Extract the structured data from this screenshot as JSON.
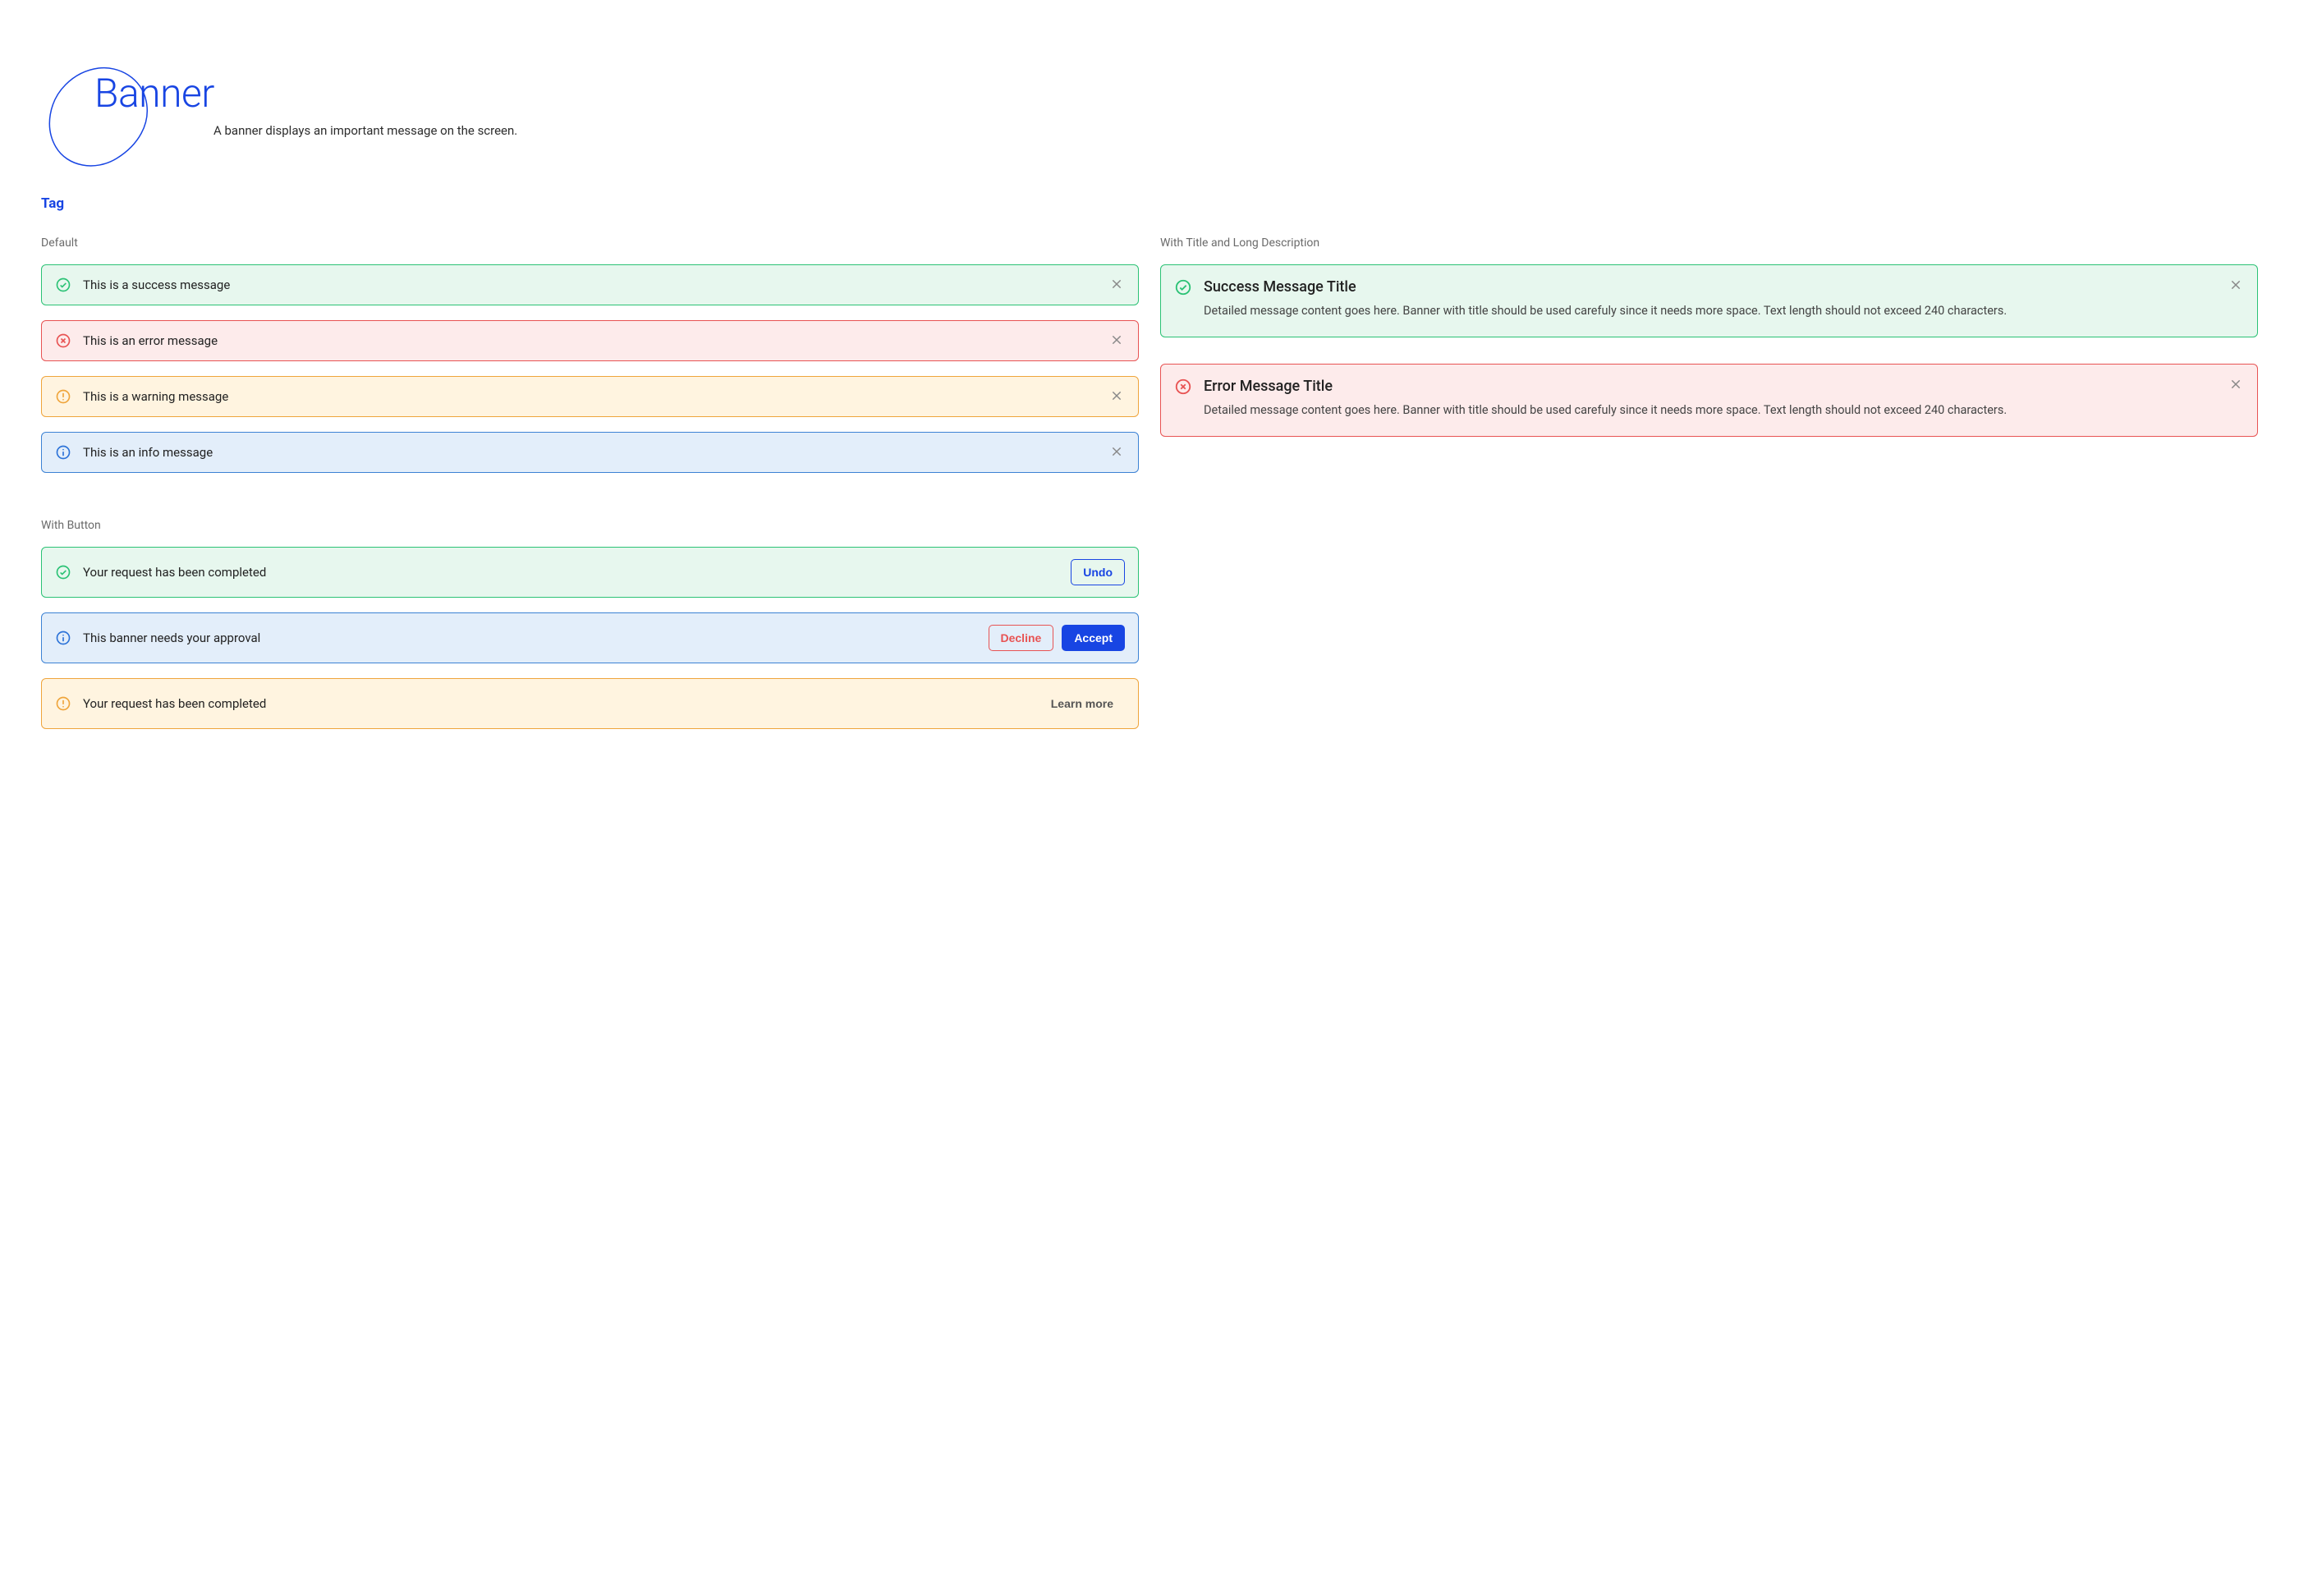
{
  "page": {
    "title": "Banner",
    "subtitle": "A banner displays an important message on the screen."
  },
  "section_heading": "Tag",
  "variant_labels": {
    "default": "Default",
    "with_title": "With Title and Long Description",
    "with_button": "With Button"
  },
  "default_banners": {
    "success": "This is a success message",
    "error": "This is an error message",
    "warning": "This is a warning message",
    "info": "This is an info message"
  },
  "titled_banners": {
    "success": {
      "title": "Success Message Title",
      "desc": "Detailed message content goes here. Banner with title should be used carefuly since it needs more space. Text length should not exceed 240 characters."
    },
    "error": {
      "title": "Error Message Title",
      "desc": "Detailed message content goes here. Banner with title should be used carefuly since it needs more space. Text length should not exceed 240 characters."
    }
  },
  "button_banners": {
    "b1": {
      "msg": "Your request has been completed",
      "undo": "Undo"
    },
    "b2": {
      "msg": "This banner needs your approval",
      "decline": "Decline",
      "accept": "Accept"
    },
    "b3": {
      "msg": "Your request has been completed",
      "learn": "Learn more"
    }
  },
  "colors": {
    "success": "#2BC275",
    "error": "#E85353",
    "warning": "#EFA53C",
    "info": "#2D73D8",
    "brand": "#1845E3"
  }
}
